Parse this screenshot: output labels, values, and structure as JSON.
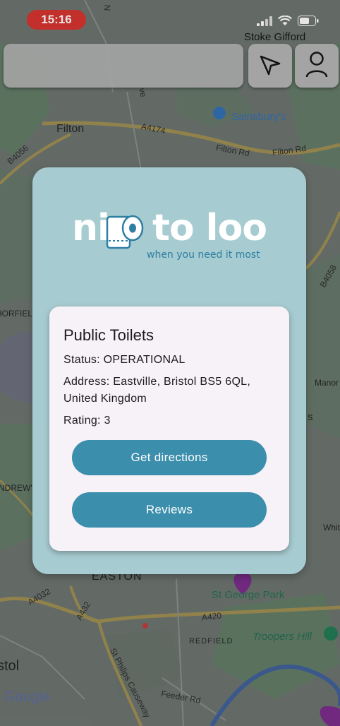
{
  "status_bar": {
    "time": "15:16",
    "area": "Stoke Gifford",
    "icons": [
      "cellular-signal-icon",
      "wifi-icon",
      "battery-icon"
    ]
  },
  "map": {
    "place_labels": {
      "filton": "Filton",
      "easton": "EASTON",
      "redfield": "REDFIELD",
      "bristol": "stol",
      "sainsburys": "Sainsbury's",
      "st_george_park": "St George Park",
      "troopers_hill": "Troopers Hill",
      "norfield": "HORFIELD",
      "andrews": "NDREW'S",
      "manor": "Manor",
      "white": "White"
    },
    "road_labels": {
      "a4174": "A4174",
      "filton_rd_1": "Filton Rd",
      "filton_rd_2": "Filton Rd",
      "b4056": "B4056",
      "b4058": "B4058",
      "a4032": "A4032",
      "a432": "A432",
      "a420": "A420",
      "feeder_rd": "Feeder Rd",
      "st_philips_causeway": "St Philips Causeway",
      "ave": "ve",
      "n_label": "N",
      "side_s": "s"
    },
    "attribution": "Google"
  },
  "top_controls": {
    "search_value": "",
    "navigate_icon": "navigation-arrow-icon",
    "profile_icon": "user-profile-icon"
  },
  "modal": {
    "logo": {
      "word_left": "ni",
      "word_right": "to loo",
      "tagline": "when you need it most",
      "icon": "toilet-roll-icon"
    },
    "toilet": {
      "name": "Public Toilets",
      "status": "Status: OPERATIONAL",
      "address": "Address: Eastville, Bristol BS5 6QL, United Kingdom",
      "rating": "Rating: 3"
    },
    "buttons": {
      "directions": "Get directions",
      "reviews": "Reviews"
    }
  },
  "colors": {
    "modal_bg": "#a6cbd0",
    "card_bg": "#f7f1f8",
    "button": "#3b8eac",
    "time_pill": "#d9302c"
  }
}
